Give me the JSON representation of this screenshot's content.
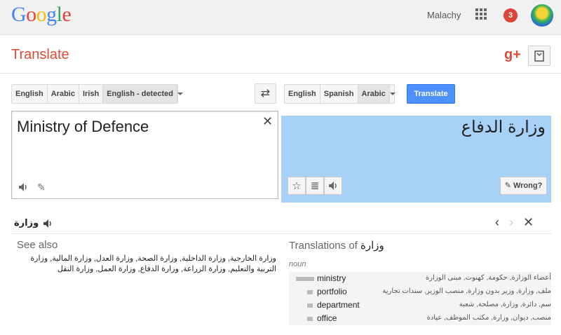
{
  "header": {
    "username": "Malachy",
    "notification_count": "3",
    "logo_letters": [
      "G",
      "o",
      "o",
      "g",
      "l",
      "e"
    ]
  },
  "app": {
    "title": "Translate",
    "gplus_label": "g+"
  },
  "source_langs": [
    "English",
    "Arabic",
    "Irish",
    "English - detected"
  ],
  "target_langs": [
    "English",
    "Spanish",
    "Arabic"
  ],
  "translate_button": "Translate",
  "source": {
    "text": "Ministry of Defence"
  },
  "result": {
    "text": "وزارة الدفاع",
    "wrong_label": "Wrong?"
  },
  "dictionary": {
    "word": "وزارة",
    "see_also_title": "See also",
    "see_also_text": "وزارة الخارجية, وزارة الداخلية, وزارة الصحة, وزارة العدل, وزارة المالية, وزارة التربية والتعليم, وزارة الزراعة, وزارة الدفاع, وزارة العمل, وزارة النقل",
    "translations_title": "Translations of",
    "pos": "noun",
    "rows": [
      {
        "word": "ministry",
        "synonyms": "أعضاء الوزارة, حكومة, كهنوت, مبنى الوزارة",
        "frequency": 1.0
      },
      {
        "word": "portfolio",
        "synonyms": "ملف, وزارة, وزير بدون وزارة, منصب الوزير, سندات تجارية",
        "frequency": 0.5
      },
      {
        "word": "department",
        "synonyms": "سم, دائرة, وزارة, مصلحة, شعبة",
        "frequency": 0.5
      },
      {
        "word": "office",
        "synonyms": "منصب, ديوان, وزارة, مكتب الموظف, عيادة",
        "frequency": 0.5
      }
    ]
  },
  "colors": {
    "brand_red": "#dd4b39",
    "button_blue": "#4d90fe",
    "result_highlight": "#a8d1f8"
  }
}
